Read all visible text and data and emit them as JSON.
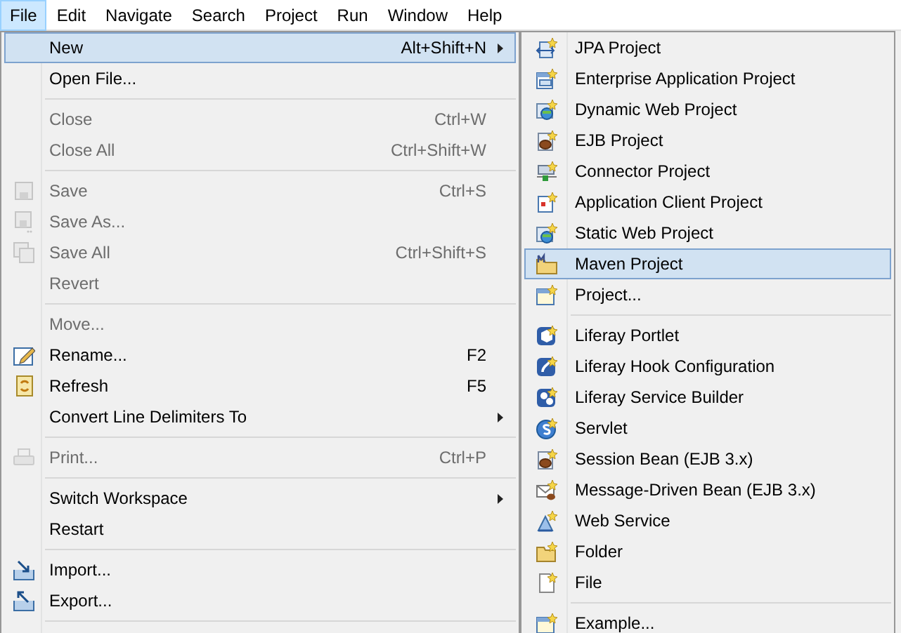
{
  "menu_bar": [
    {
      "label": "File",
      "selected": true
    },
    {
      "label": "Edit",
      "selected": false
    },
    {
      "label": "Navigate",
      "selected": false
    },
    {
      "label": "Search",
      "selected": false
    },
    {
      "label": "Project",
      "selected": false
    },
    {
      "label": "Run",
      "selected": false
    },
    {
      "label": "Window",
      "selected": false
    },
    {
      "label": "Help",
      "selected": false
    }
  ],
  "file_menu": [
    {
      "kind": "plain",
      "label": "New",
      "shortcut": "Alt+Shift+N",
      "submenu": true,
      "disabled": false,
      "selected": true
    },
    {
      "kind": "plain",
      "label": "Open File...",
      "submenu": false,
      "disabled": false,
      "selected": false
    },
    {
      "kind": "separator"
    },
    {
      "kind": "plain",
      "label": "Close",
      "shortcut": "Ctrl+W",
      "submenu": false,
      "disabled": true,
      "selected": false
    },
    {
      "kind": "plain",
      "label": "Close All",
      "shortcut": "Ctrl+Shift+W",
      "submenu": false,
      "disabled": true,
      "selected": false
    },
    {
      "kind": "separator"
    },
    {
      "kind": "save",
      "label": "Save",
      "shortcut": "Ctrl+S",
      "submenu": false,
      "disabled": true,
      "selected": false
    },
    {
      "kind": "saveas",
      "label": "Save As...",
      "submenu": false,
      "disabled": true,
      "selected": false
    },
    {
      "kind": "saveall",
      "label": "Save All",
      "shortcut": "Ctrl+Shift+S",
      "submenu": false,
      "disabled": true,
      "selected": false
    },
    {
      "kind": "plain",
      "label": "Revert",
      "submenu": false,
      "disabled": true,
      "selected": false
    },
    {
      "kind": "separator"
    },
    {
      "kind": "plain",
      "label": "Move...",
      "submenu": false,
      "disabled": true,
      "selected": false
    },
    {
      "kind": "rename",
      "label": "Rename...",
      "shortcut": "F2",
      "submenu": false,
      "disabled": false,
      "selected": false
    },
    {
      "kind": "refresh",
      "label": "Refresh",
      "shortcut": "F5",
      "submenu": false,
      "disabled": false,
      "selected": false
    },
    {
      "kind": "plain",
      "label": "Convert Line Delimiters To",
      "submenu": true,
      "disabled": false,
      "selected": false
    },
    {
      "kind": "separator"
    },
    {
      "kind": "print",
      "label": "Print...",
      "shortcut": "Ctrl+P",
      "submenu": false,
      "disabled": true,
      "selected": false
    },
    {
      "kind": "separator"
    },
    {
      "kind": "plain",
      "label": "Switch Workspace",
      "submenu": true,
      "disabled": false,
      "selected": false
    },
    {
      "kind": "plain",
      "label": "Restart",
      "submenu": false,
      "disabled": false,
      "selected": false
    },
    {
      "kind": "separator"
    },
    {
      "kind": "import",
      "label": "Import...",
      "submenu": false,
      "disabled": false,
      "selected": false
    },
    {
      "kind": "export",
      "label": "Export...",
      "submenu": false,
      "disabled": false,
      "selected": false
    },
    {
      "kind": "separator"
    }
  ],
  "new_submenu": [
    {
      "kind": "jpa",
      "label": "JPA Project",
      "selected": false
    },
    {
      "kind": "ear",
      "label": "Enterprise Application Project",
      "selected": false
    },
    {
      "kind": "web",
      "label": "Dynamic Web Project",
      "selected": false
    },
    {
      "kind": "bean",
      "label": "EJB Project",
      "selected": false
    },
    {
      "kind": "connector",
      "label": "Connector Project",
      "selected": false
    },
    {
      "kind": "client",
      "label": "Application Client Project",
      "selected": false
    },
    {
      "kind": "web",
      "label": "Static Web Project",
      "selected": false
    },
    {
      "kind": "maven",
      "label": "Maven Project",
      "selected": true
    },
    {
      "kind": "window",
      "label": "Project...",
      "selected": false
    },
    {
      "kind": "separator"
    },
    {
      "kind": "portlet",
      "label": "Liferay Portlet",
      "selected": false
    },
    {
      "kind": "hook",
      "label": "Liferay Hook Configuration",
      "selected": false
    },
    {
      "kind": "gears",
      "label": "Liferay Service Builder",
      "selected": false
    },
    {
      "kind": "servlet",
      "label": "Servlet",
      "selected": false
    },
    {
      "kind": "bean",
      "label": "Session Bean (EJB 3.x)",
      "selected": false
    },
    {
      "kind": "envelope",
      "label": "Message-Driven Bean (EJB 3.x)",
      "selected": false
    },
    {
      "kind": "webservice",
      "label": "Web Service",
      "selected": false
    },
    {
      "kind": "folder",
      "label": "Folder",
      "selected": false
    },
    {
      "kind": "file",
      "label": "File",
      "selected": false
    },
    {
      "kind": "separator"
    },
    {
      "kind": "window",
      "label": "Example...",
      "selected": false
    }
  ]
}
